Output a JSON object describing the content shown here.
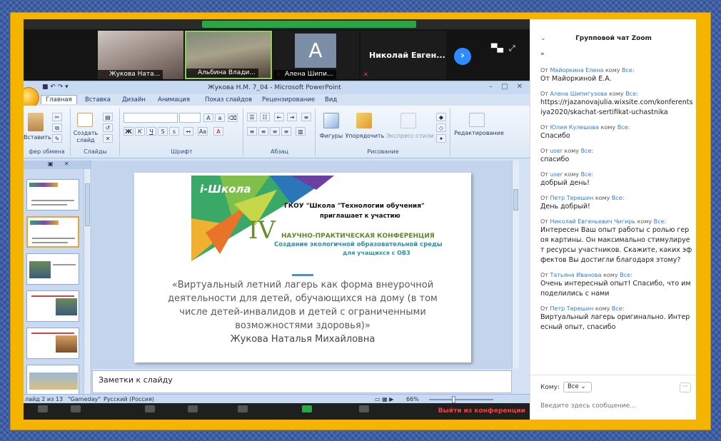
{
  "videos": [
    {
      "name": "Жукова Ната...",
      "muted": true
    },
    {
      "name": "Альбина Влади...",
      "muted": false
    },
    {
      "name": "Алена Шипи...",
      "muted": true,
      "letter": "A"
    },
    {
      "name": "",
      "muted": true,
      "display": "Николай  Евген..."
    }
  ],
  "ppt": {
    "title": "Жукова Н.М. 7_04 - Microsoft PowerPoint",
    "tabs": [
      "Главная",
      "Вставка",
      "Дизайн",
      "Анимация",
      "Показ слайдов",
      "Рецензирование",
      "Вид"
    ],
    "groups": {
      "clipboard": "фер обмена",
      "slides": "Слайды",
      "font": "Шрифт",
      "paragraph": "Абзац",
      "drawing": "Рисование"
    },
    "buttons": {
      "paste": "Вставить",
      "new_slide_1": "Создать",
      "new_slide_2": "слайд",
      "shapes": "Фигуры",
      "arrange": "Упорядочить",
      "quick_styles": "Экспресс-стили",
      "editing": "Редактирование"
    },
    "slide": {
      "school": "i-Школа",
      "org": "ГКОУ \"Школа \"Технологии обучения\"",
      "invite": "приглашает к участию",
      "roman": "IV",
      "conf": "НАУЧНО-ПРАКТИЧЕСКАЯ КОНФЕРЕНЦИЯ",
      "conf2": "Создание экологичной образовательной среды",
      "conf3": "для учащихся с ОВЗ",
      "line1": "«Виртуальный летний лагерь как форма внеурочной",
      "line2": "деятельности для детей, обучающихся на дому (в том",
      "line3": "числе детей-инвалидов и детей с ограниченными",
      "line4": "возможностями здоровья)»",
      "author": "Жукова Наталья Михайловна"
    },
    "notes": "Заметки к слайду",
    "status": {
      "slide": "лайд 2 из 13",
      "theme": "\"Gameday\"",
      "lang": "Русский (Россия)",
      "zoom": "66%"
    }
  },
  "meeting": {
    "leave": "Выйти из конференции"
  },
  "chat": {
    "title": "Групповой чат Zoom",
    "sub": "»",
    "messages": [
      {
        "from": "Майоркина Елена",
        "to": "Все",
        "text": "От Майоркиной Е.А."
      },
      {
        "from": "Алена Шипигузова",
        "to": "Все",
        "text": "https://rjazanovajulia.wixsite.com/konferentsiya2020/skachat-sertifikat-uchastnika"
      },
      {
        "from": "Юлия Кулешова",
        "to": "Все",
        "text": "Спасибо"
      },
      {
        "from": "user",
        "to": "Все",
        "text": "спасибо"
      },
      {
        "from": "user",
        "to": "Все",
        "text": "добрый день!"
      },
      {
        "from": "Петр Терешин",
        "to": "Все",
        "text": "День добрый!"
      },
      {
        "from": "Николай Евгеньевич Чигирь",
        "to": "Все",
        "text": "Интересен Ваш опыт работы с ролью героя картины. Он максимально стимулирует ресурсы участников. Скажите, каких эффектов Вы достигли благодаря этому?"
      },
      {
        "from": "Татьяна Иванова",
        "to": "Все",
        "text": "Очень интересный опыт! Спасибо, что им поделились с нами"
      },
      {
        "from": "Петр Терешин",
        "to": "Все",
        "text": "Виртуальный лагерь оригинально. Интересный опыт, спасибо"
      }
    ],
    "labels": {
      "from": "От",
      "to": "кому"
    },
    "to_label": "Кому:",
    "to_value": "Все",
    "placeholder": "Введите здесь сообщение..."
  }
}
